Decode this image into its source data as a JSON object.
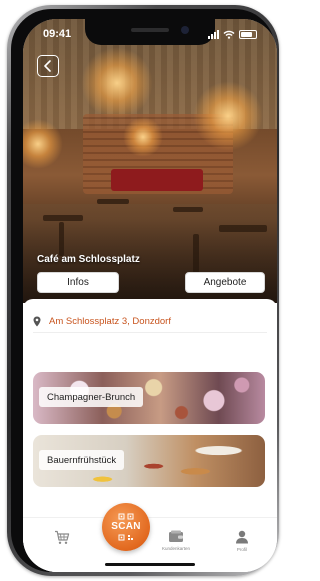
{
  "status_bar": {
    "time": "09:41"
  },
  "header": {
    "back_icon": "chevron-left-icon",
    "title": "Café am Schlossplatz"
  },
  "tabs": [
    {
      "label": "Infos"
    },
    {
      "label": "Angebote"
    }
  ],
  "address": {
    "icon": "map-pin-icon",
    "text": "Am Schlossplatz 3, Donzdorf",
    "color": "#c8541e"
  },
  "offers": [
    {
      "label": "Champagner-Brunch"
    },
    {
      "label": "Bauernfrühstück"
    }
  ],
  "tabbar": {
    "cart_icon": "shopping-cart-icon",
    "scan_label": "SCAN",
    "scan_icon": "qr-code-icon",
    "cards_label": "Kundenkarten",
    "cards_icon": "wallet-icon",
    "profile_label": "Profil",
    "profile_icon": "user-icon"
  },
  "colors": {
    "accent": "#e2691f"
  }
}
